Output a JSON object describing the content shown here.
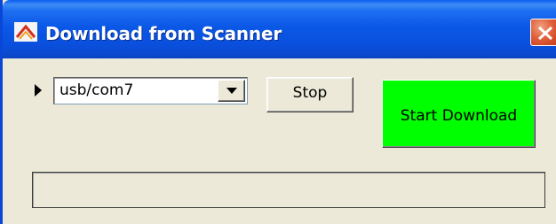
{
  "window": {
    "title": "Download from Scanner",
    "title_icon": "scanner-app-icon",
    "close_icon": "close-icon"
  },
  "port_select": {
    "value": "usb/com7",
    "pointer_icon": "triangle-right-icon",
    "dropdown_icon": "chevron-down-icon"
  },
  "buttons": {
    "stop_label": "Stop",
    "start_label": "Start Download"
  },
  "progress": {
    "value": 0
  },
  "colors": {
    "start_button_bg": "#00ff00",
    "close_button_bg": "#e0603a",
    "titlebar": "#0a58e6"
  }
}
